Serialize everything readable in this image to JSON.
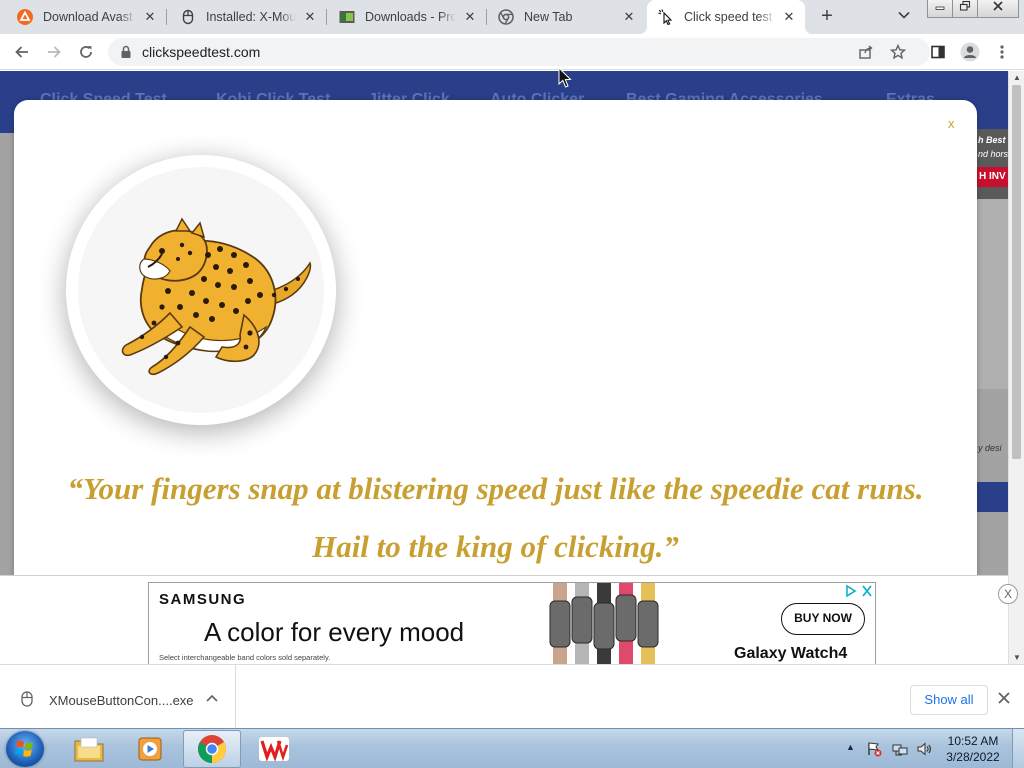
{
  "browser": {
    "tabs": [
      {
        "title": "Download Avast F",
        "icon": "avast-icon",
        "active": false
      },
      {
        "title": "Installed: X-Mous",
        "icon": "mouse-icon",
        "active": false
      },
      {
        "title": "Downloads - Proc",
        "icon": "downloads-icon",
        "active": false
      },
      {
        "title": "New Tab",
        "icon": "chrome-icon",
        "active": false
      },
      {
        "title": "Click speed test -",
        "icon": "cursor-click-icon",
        "active": true
      }
    ],
    "new_tab_label": "+",
    "url": "clickspeedtest.com"
  },
  "site": {
    "nav": [
      "Click Speed Test",
      "Kohi Click Test",
      "Jitter Click",
      "Auto Clicker",
      "Best Gaming Accessories",
      "Extras"
    ],
    "side_ad": {
      "line1": "h Best",
      "line2": "nd hors",
      "line3": "H INV",
      "caption": "y desi"
    }
  },
  "modal": {
    "close_label": "x",
    "quote_line1": "“Your fingers snap at blistering speed just like the speedie cat runs.",
    "quote_line2": "Hail to the king of clicking.”"
  },
  "ad": {
    "brand": "SAMSUNG",
    "headline": "A color for every mood",
    "fine_print": "Select interchangeable band colors sold separately.",
    "cta": "BUY NOW",
    "product": "Galaxy Watch4",
    "close_label": "X"
  },
  "downloads": {
    "filename": "XMouseButtonCon....exe",
    "show_all": "Show all"
  },
  "taskbar": {
    "time": "10:52 AM",
    "date": "3/28/2022"
  },
  "colors": {
    "quote_gold": "#c8a032",
    "site_nav_blue": "#2a3f8a",
    "link_blue": "#1a73e8"
  }
}
